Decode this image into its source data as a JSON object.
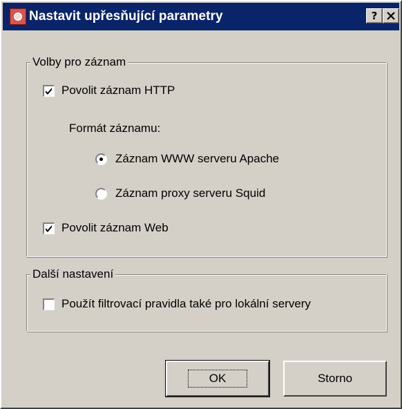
{
  "window": {
    "title": "Nastavit upřesňující parametry",
    "help_label": "?",
    "close_label": "✕"
  },
  "log_options": {
    "legend": "Volby pro záznam",
    "enable_http_log": {
      "label": "Povolit záznam HTTP",
      "checked": true
    },
    "format_label": "Formát záznamu:",
    "format_apache": {
      "label": "Záznam WWW serveru Apache",
      "selected": true
    },
    "format_squid": {
      "label": "Záznam proxy serveru Squid",
      "selected": false
    },
    "enable_web_log": {
      "label": "Povolit záznam Web",
      "checked": true
    }
  },
  "other_settings": {
    "legend": "Další nastavení",
    "local_filter": {
      "label": "Použít filtrovací pravidla také pro lokální servery",
      "checked": false
    }
  },
  "buttons": {
    "ok": "OK",
    "cancel": "Storno"
  }
}
